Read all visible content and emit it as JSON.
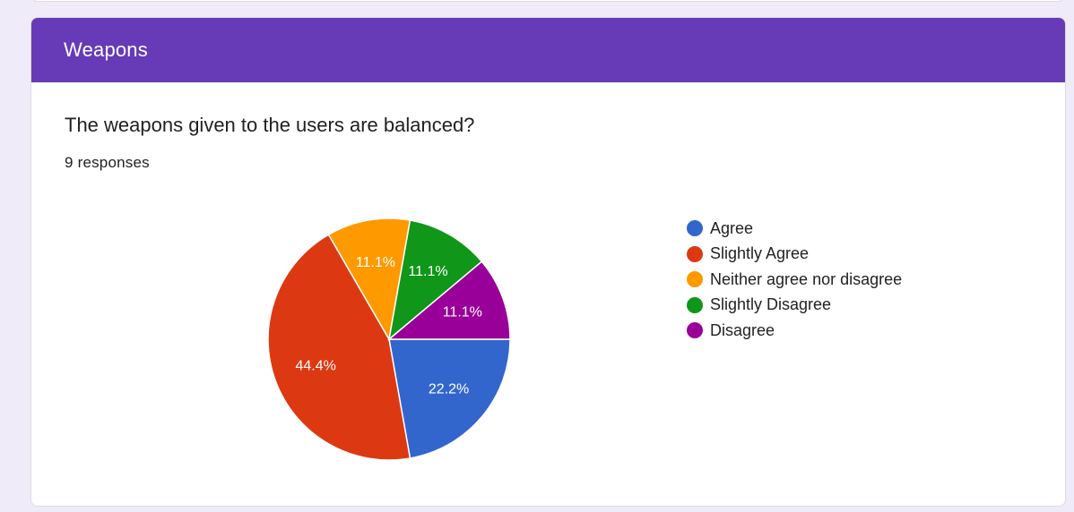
{
  "section": {
    "title": "Weapons",
    "header_color": "#673ab7"
  },
  "question": {
    "title": "The weapons given to the users are balanced?",
    "responses": "9 responses"
  },
  "chart_data": {
    "type": "pie",
    "title": "",
    "slices": [
      {
        "label": "Agree",
        "value": 22.2,
        "display": "22.2%",
        "color": "#3366cc"
      },
      {
        "label": "Slightly Agree",
        "value": 44.4,
        "display": "44.4%",
        "color": "#dc3912"
      },
      {
        "label": "Neither agree nor disagree",
        "value": 11.1,
        "display": "11.1%",
        "color": "#ff9900"
      },
      {
        "label": "Slightly Disagree",
        "value": 11.1,
        "display": "11.1%",
        "color": "#109618"
      },
      {
        "label": "Disagree",
        "value": 11.1,
        "display": "11.1%",
        "color": "#990099"
      }
    ],
    "start_angle_deg": 90,
    "direction": "clockwise",
    "legend_position": "right"
  }
}
